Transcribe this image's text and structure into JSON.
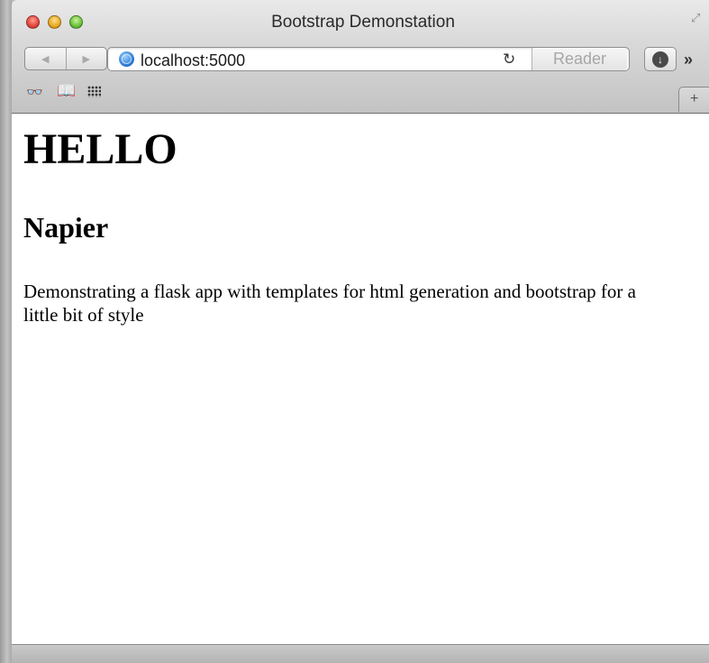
{
  "window": {
    "title": "Bootstrap Demonstation"
  },
  "toolbar": {
    "back_icon": "◀",
    "forward_icon": "▶",
    "url": "localhost:5000",
    "reload_icon": "↻",
    "reader_label": "Reader",
    "download_icon": "↓",
    "more_icon": "»"
  },
  "bookmarks": {
    "reading_list_icon": "reading-list-glasses",
    "bookmarks_icon": "open-book",
    "top_sites_icon": "grid",
    "new_tab_label": "+"
  },
  "page": {
    "heading": "HELLO",
    "subheading": "Napier",
    "paragraph": "Demonstrating a flask app with templates for html generation and bootstrap for a little bit of style"
  }
}
